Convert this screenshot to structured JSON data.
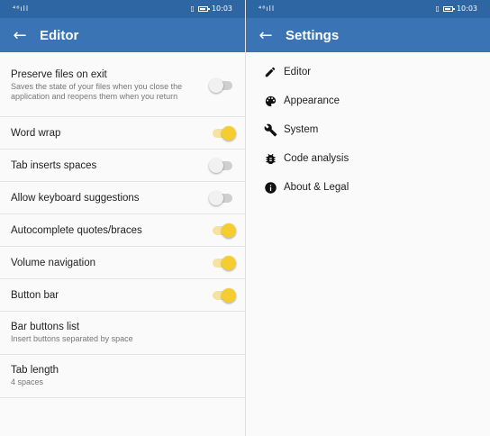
{
  "status_bar": {
    "signal": "⁴⁶ıll",
    "time": "10:03"
  },
  "editor": {
    "title": "Editor",
    "settings": [
      {
        "title": "Preserve files on exit",
        "subtitle": "Saves the state of your files when you close the application and reopens them when you return",
        "toggle": false
      },
      {
        "title": "Word wrap",
        "toggle": true
      },
      {
        "title": "Tab inserts spaces",
        "toggle": false
      },
      {
        "title": "Allow keyboard suggestions",
        "toggle": false
      },
      {
        "title": "Autocomplete quotes/braces",
        "toggle": true
      },
      {
        "title": "Volume navigation",
        "toggle": true
      },
      {
        "title": "Button bar",
        "toggle": true
      },
      {
        "title": "Bar buttons list",
        "subtitle": "Insert buttons separated by space"
      },
      {
        "title": "Tab length",
        "subtitle": "4 spaces"
      }
    ]
  },
  "settings": {
    "title": "Settings",
    "items": [
      {
        "label": "Editor",
        "icon": "pencil-icon"
      },
      {
        "label": "Appearance",
        "icon": "palette-icon"
      },
      {
        "label": "System",
        "icon": "wrench-icon"
      },
      {
        "label": "Code analysis",
        "icon": "bug-icon"
      },
      {
        "label": "About & Legal",
        "icon": "info-icon"
      }
    ]
  },
  "colors": {
    "status_bar": "#2e65a3",
    "app_bar": "#3a74b5",
    "toggle_on": "#f5cd2f",
    "toggle_off": "#f1f1f1"
  }
}
